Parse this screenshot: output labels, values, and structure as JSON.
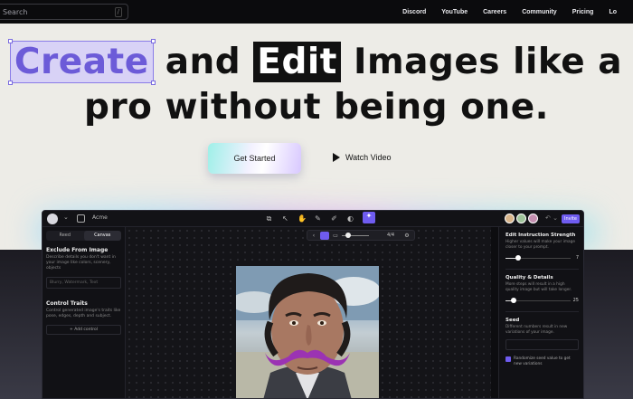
{
  "nav": {
    "search_placeholder": "Search",
    "search_shortcut": "/",
    "links": [
      "Discord",
      "YouTube",
      "Careers",
      "Community",
      "Pricing",
      "Lo"
    ]
  },
  "hero": {
    "line1_word1": "Create",
    "line1_word2": "and",
    "line1_word3": "Edit",
    "line1_rest": "Images like a",
    "line2": "pro without being one.",
    "cta_label": "Get Started",
    "watch_label": "Watch Video"
  },
  "app": {
    "project_name": "Acme",
    "share_label": "Invite",
    "zoom_value": "4/4",
    "left_tabs": [
      "Reed",
      "Canvas"
    ],
    "left_active_tab": "Canvas",
    "exclude_title": "Exclude From Image",
    "exclude_desc": "Describe details you don't want in your image like colors, scenery, objects",
    "exclude_placeholder": "Blurry, Watermark, Text",
    "control_title": "Control Traits",
    "control_desc": "Control generated image's traits like pose, edges, depth and subject.",
    "add_control_label": "+ Add control",
    "strength_title": "Edit Instruction Strength",
    "strength_desc": "Higher values will make your image closer to your prompt.",
    "strength_value": "7",
    "strength_fraction": 0.2,
    "quality_title": "Quality & Details",
    "quality_desc": "More steps will result in a high quality image but will take longer.",
    "quality_value": "25",
    "quality_fraction": 0.12,
    "seed_title": "Seed",
    "seed_desc": "Different numbers result in new variations of your image.",
    "random_seed_label": "Randomize seed value to get new variations",
    "avatar_colors": [
      "#d8b48a",
      "#9fc39a",
      "#c48fb0"
    ]
  },
  "colors": {
    "accent": "#6f5cf0",
    "create_text": "#6c5bd8",
    "create_bg": "#d8d2f6"
  }
}
